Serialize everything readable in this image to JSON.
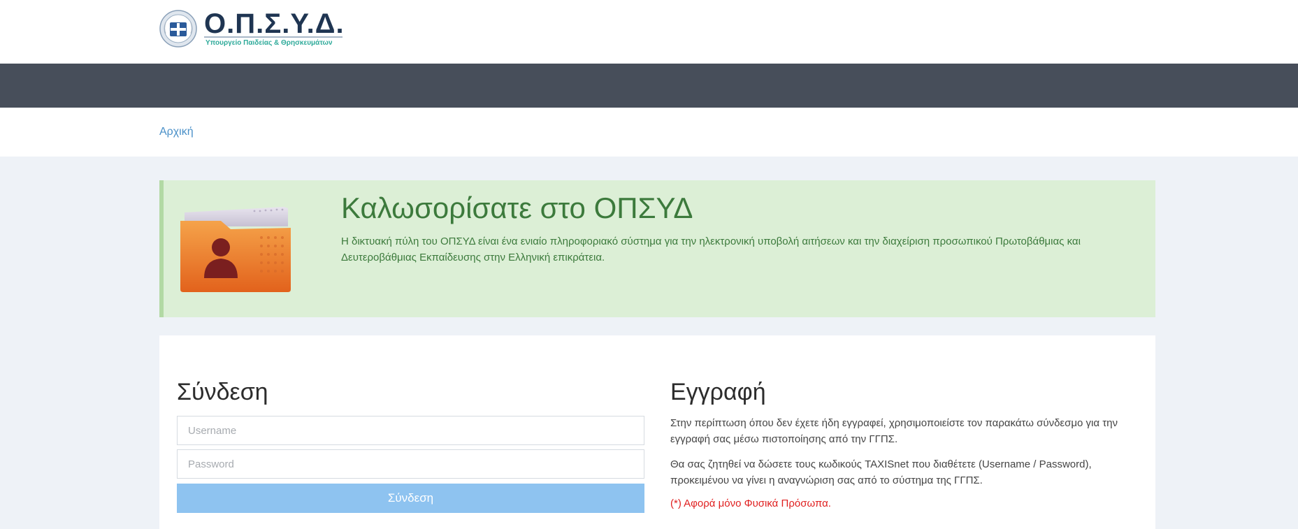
{
  "header": {
    "logo_name": "Ο.Π.Σ.Υ.Δ.",
    "logo_subtitle": "Υπουργείο Παιδείας & Θρησκευμάτων",
    "logo_icon": "greek-seal-icon"
  },
  "breadcrumb": {
    "home": "Αρχική"
  },
  "welcome": {
    "title": "Καλωσορίσατε στο ΟΠΣΥΔ",
    "text": "Η δικτυακή πύλη του ΟΠΣΥΔ είναι ένα ενιαίο πληροφοριακό σύστημα για την ηλεκτρονική υποβολή αιτήσεων και την διαχείριση προσωπικού Πρωτοβάθμιας και Δευτεροβάθμιας Εκπαίδευσης στην Ελληνική επικράτεια.",
    "icon": "user-folder-icon"
  },
  "login": {
    "title": "Σύνδεση",
    "username_placeholder": "Username",
    "username_value": "",
    "password_placeholder": "Password",
    "password_value": "",
    "button": "Σύνδεση"
  },
  "register": {
    "title": "Εγγραφή",
    "p1": "Στην περίπτωση όπου δεν έχετε ήδη εγγραφεί, χρησιμοποιείστε τον παρακάτω σύνδεσμο για την εγγραφή σας μέσω πιστοποίησης από την ΓΓΠΣ.",
    "p2": "Θα σας ζητηθεί να δώσετε τους κωδικούς TAXISnet που διαθέτετε (Username / Password), προκειμένου να γίνει η αναγνώριση σας από το σύστημα της ΓΓΠΣ.",
    "note": "(*) Αφορά μόνο Φυσικά Πρόσωπα."
  },
  "colors": {
    "navbar": "#474e5a",
    "welcome_bg": "#dcefd6",
    "welcome_text": "#3c7a3c",
    "link": "#4a90c8",
    "button": "#8ec3f0",
    "note": "#e02020"
  }
}
